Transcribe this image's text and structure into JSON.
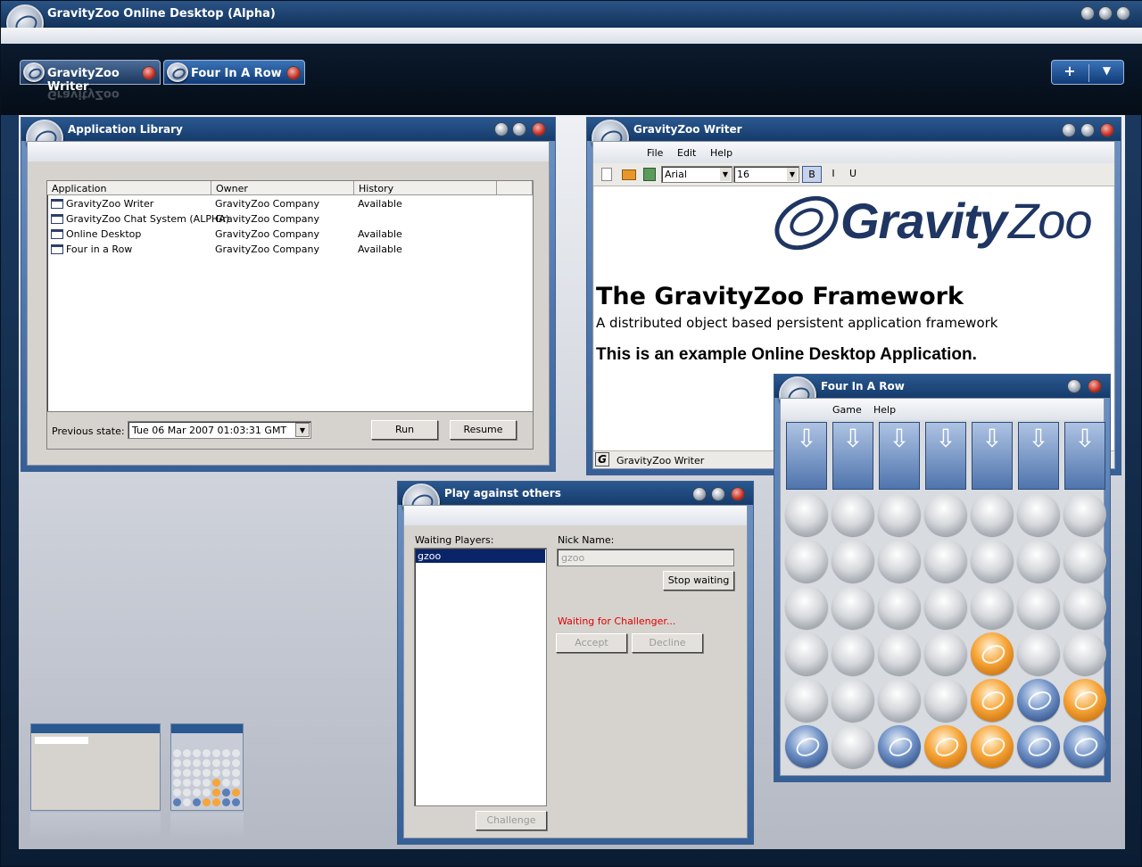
{
  "app": {
    "title": "GravityZoo Online Desktop (Alpha)"
  },
  "tabs": [
    {
      "label": "GravityZoo Writer"
    },
    {
      "label": "Four In A Row"
    }
  ],
  "tabbar": {
    "plus": "+",
    "menu": "▼"
  },
  "library": {
    "title": "Application Library",
    "columns": [
      "Application",
      "Owner",
      "History"
    ],
    "rows": [
      {
        "app": "GravityZoo Writer",
        "owner": "GravityZoo Company",
        "history": "Available"
      },
      {
        "app": "GravityZoo Chat System (ALPHA)",
        "owner": "GravityZoo Company",
        "history": ""
      },
      {
        "app": "Online Desktop",
        "owner": "GravityZoo Company",
        "history": "Available"
      },
      {
        "app": "Four in a Row",
        "owner": "GravityZoo Company",
        "history": "Available"
      }
    ],
    "prev_label": "Previous state:",
    "prev_value": "Tue 06 Mar 2007 01:03:31 GMT",
    "run": "Run",
    "resume": "Resume"
  },
  "writer": {
    "title": "GravityZoo Writer",
    "menu": [
      "File",
      "Edit",
      "Help"
    ],
    "font": "Arial",
    "size": "16",
    "bold": "B",
    "italic": "I",
    "underline": "U",
    "logo_text_a": "Gravity",
    "logo_text_b": "Zoo",
    "heading": "The GravityZoo Framework",
    "subheading": "A distributed object based persistent application framework",
    "body": "This is an example Online Desktop Application.",
    "status": "GravityZoo Writer",
    "status_icon": "G"
  },
  "play": {
    "title": "Play against others",
    "waiting_label": "Waiting Players:",
    "players": [
      "gzoo"
    ],
    "nick_label": "Nick Name:",
    "nick_value": "gzoo",
    "stop": "Stop waiting",
    "status": "Waiting for Challenger...",
    "status_color": "#e00000",
    "accept": "Accept",
    "decline": "Decline",
    "challenge": "Challenge"
  },
  "fourrow": {
    "title": "Four In A Row",
    "menu": [
      "Game",
      "Help"
    ],
    "board": [
      [
        "e",
        "e",
        "e",
        "e",
        "e",
        "e",
        "e"
      ],
      [
        "e",
        "e",
        "e",
        "e",
        "e",
        "e",
        "e"
      ],
      [
        "e",
        "e",
        "e",
        "e",
        "e",
        "e",
        "e"
      ],
      [
        "e",
        "e",
        "e",
        "e",
        "o",
        "e",
        "e"
      ],
      [
        "e",
        "e",
        "e",
        "e",
        "o",
        "b",
        "o"
      ],
      [
        "b",
        "e",
        "b",
        "o",
        "o",
        "b",
        "b"
      ]
    ]
  }
}
